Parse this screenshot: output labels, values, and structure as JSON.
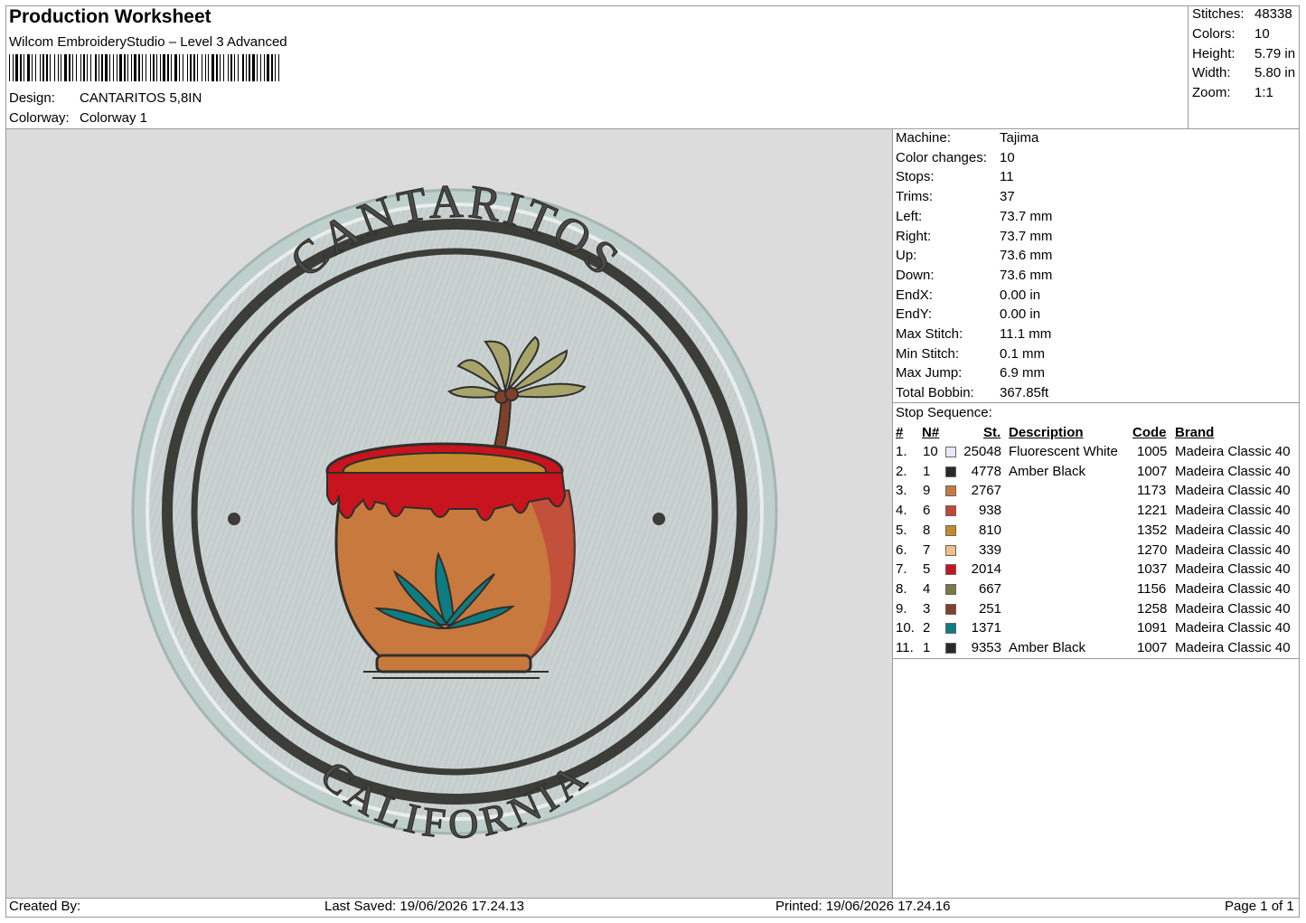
{
  "header": {
    "title": "Production Worksheet",
    "subtitle": "Wilcom EmbroideryStudio – Level 3 Advanced",
    "design_label": "Design:",
    "design_value": "CANTARITOS 5,8IN",
    "colorway_label": "Colorway:",
    "colorway_value": "Colorway 1"
  },
  "summary": [
    {
      "label": "Stitches:",
      "value": "48338"
    },
    {
      "label": "Colors:",
      "value": "10"
    },
    {
      "label": "Height:",
      "value": "5.79 in"
    },
    {
      "label": "Width:",
      "value": "5.80 in"
    },
    {
      "label": "Zoom:",
      "value": "1:1"
    }
  ],
  "machine_stats": [
    {
      "label": "Machine:",
      "value": "Tajima"
    },
    {
      "label": "Color changes:",
      "value": "10"
    },
    {
      "label": "Stops:",
      "value": "11"
    },
    {
      "label": "Trims:",
      "value": "37"
    },
    {
      "label": "Left:",
      "value": "73.7 mm"
    },
    {
      "label": "Right:",
      "value": "73.7 mm"
    },
    {
      "label": "Up:",
      "value": "73.6 mm"
    },
    {
      "label": "Down:",
      "value": "73.6 mm"
    },
    {
      "label": "EndX:",
      "value": "0.00 in"
    },
    {
      "label": "EndY:",
      "value": "0.00 in"
    },
    {
      "label": "Max Stitch:",
      "value": "11.1 mm"
    },
    {
      "label": "Min Stitch:",
      "value": "0.1 mm"
    },
    {
      "label": "Max Jump:",
      "value": "6.9 mm"
    },
    {
      "label": "Total Bobbin:",
      "value": "367.85ft"
    }
  ],
  "stop_sequence": {
    "title": "Stop Sequence:",
    "headers": {
      "num": "#",
      "needle": "N#",
      "stitches": "St.",
      "description": "Description",
      "code": "Code",
      "brand": "Brand"
    },
    "rows": [
      {
        "num": "1.",
        "needle": "10",
        "color": "#e6e8f8",
        "stitches": "25048",
        "description": "Fluorescent White",
        "code": "1005",
        "brand": "Madeira Classic 40"
      },
      {
        "num": "2.",
        "needle": "1",
        "color": "#2a2a2a",
        "stitches": "4778",
        "description": "Amber Black",
        "code": "1007",
        "brand": "Madeira Classic 40"
      },
      {
        "num": "3.",
        "needle": "9",
        "color": "#c8793e",
        "stitches": "2767",
        "description": "",
        "code": "1173",
        "brand": "Madeira Classic 40"
      },
      {
        "num": "4.",
        "needle": "6",
        "color": "#c2463a",
        "stitches": "938",
        "description": "",
        "code": "1221",
        "brand": "Madeira Classic 40"
      },
      {
        "num": "5.",
        "needle": "8",
        "color": "#c48b2e",
        "stitches": "810",
        "description": "",
        "code": "1352",
        "brand": "Madeira Classic 40"
      },
      {
        "num": "6.",
        "needle": "7",
        "color": "#eebf86",
        "stitches": "339",
        "description": "",
        "code": "1270",
        "brand": "Madeira Classic 40"
      },
      {
        "num": "7.",
        "needle": "5",
        "color": "#c8141e",
        "stitches": "2014",
        "description": "",
        "code": "1037",
        "brand": "Madeira Classic 40"
      },
      {
        "num": "8.",
        "needle": "4",
        "color": "#7c7a44",
        "stitches": "667",
        "description": "",
        "code": "1156",
        "brand": "Madeira Classic 40"
      },
      {
        "num": "9.",
        "needle": "3",
        "color": "#80402a",
        "stitches": "251",
        "description": "",
        "code": "1258",
        "brand": "Madeira Classic 40"
      },
      {
        "num": "10.",
        "needle": "2",
        "color": "#0e7c80",
        "stitches": "1371",
        "description": "",
        "code": "1091",
        "brand": "Madeira Classic 40"
      },
      {
        "num": "11.",
        "needle": "1",
        "color": "#2a2a2a",
        "stitches": "9353",
        "description": "Amber Black",
        "code": "1007",
        "brand": "Madeira Classic 40"
      }
    ]
  },
  "design": {
    "top_text": "CANTARITOS",
    "bottom_text": "CALIFORNIA"
  },
  "footer": {
    "created_by": "Created By:",
    "last_saved": "Last Saved: 19/06/2026 17.24.13",
    "printed": "Printed: 19/06/2026 17.24.16",
    "page": "Page 1 of 1"
  }
}
